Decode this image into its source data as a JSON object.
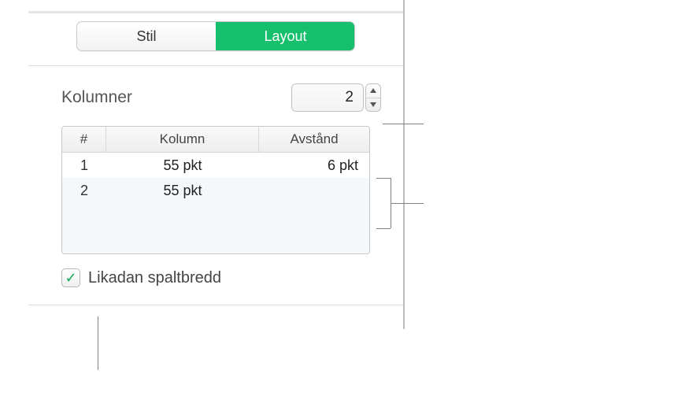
{
  "tabs": {
    "stil": "Stil",
    "layout": "Layout",
    "active": "layout"
  },
  "columns": {
    "label": "Kolumner",
    "value": "2"
  },
  "table": {
    "headers": {
      "num": "#",
      "kolumn": "Kolumn",
      "avstand": "Avstånd"
    },
    "rows": [
      {
        "num": "1",
        "kolumn": "55 pkt",
        "avstand": "6 pkt"
      },
      {
        "num": "2",
        "kolumn": "55 pkt",
        "avstand": ""
      }
    ]
  },
  "equalWidth": {
    "label": "Likadan spaltbredd",
    "checked": true
  }
}
